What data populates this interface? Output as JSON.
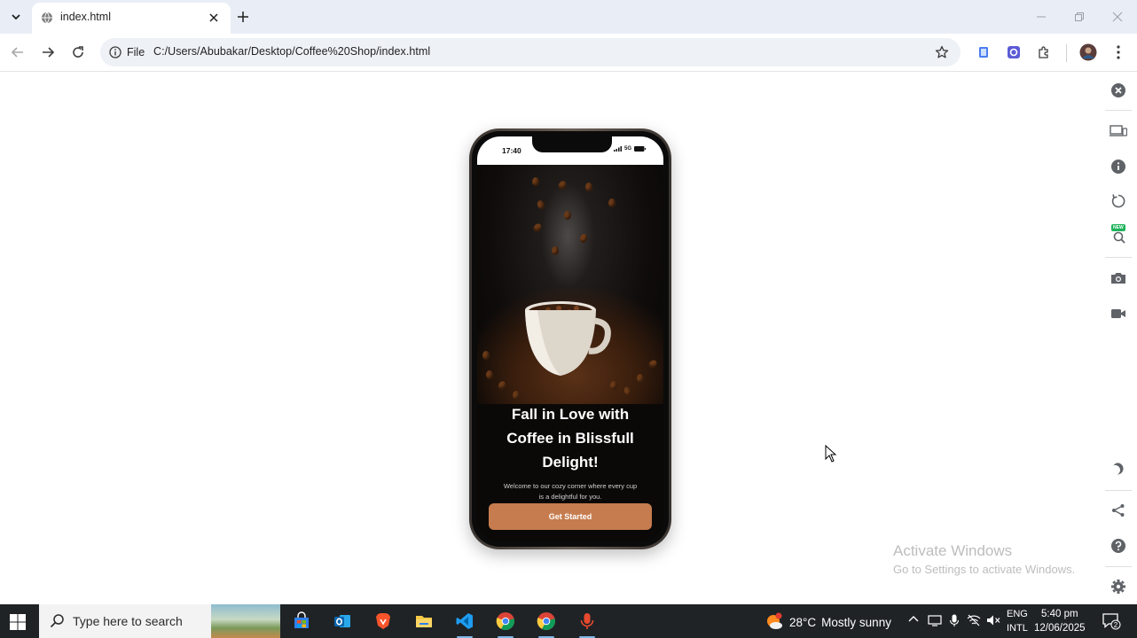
{
  "browser": {
    "tab": {
      "title": "index.html"
    },
    "address": {
      "chip_label": "File",
      "url": "C:/Users/Abubakar/Desktop/Coffee%20Shop/index.html"
    }
  },
  "phone": {
    "status_time": "17:40",
    "network": "5G",
    "headline_line1": "Fall in Love with",
    "headline_line2": "Coffee in Blissfull",
    "headline_line3": "Delight!",
    "subtext_line1": "Welcome to our cozy corner where every cup",
    "subtext_line2": "is a delightful for you.",
    "cta_label": "Get Started",
    "accent_color": "#c67c4e"
  },
  "devtools_rail": {
    "new_badge": "NEW"
  },
  "watermark": {
    "line1": "Activate Windows",
    "line2": "Go to Settings to activate Windows."
  },
  "taskbar": {
    "search_placeholder": "Type here to search",
    "weather": {
      "temp": "28°C",
      "condition": "Mostly sunny"
    },
    "lang_line1": "ENG",
    "lang_line2": "INTL",
    "time": "5:40 pm",
    "date": "12/06/2025",
    "notification_count": "2"
  }
}
